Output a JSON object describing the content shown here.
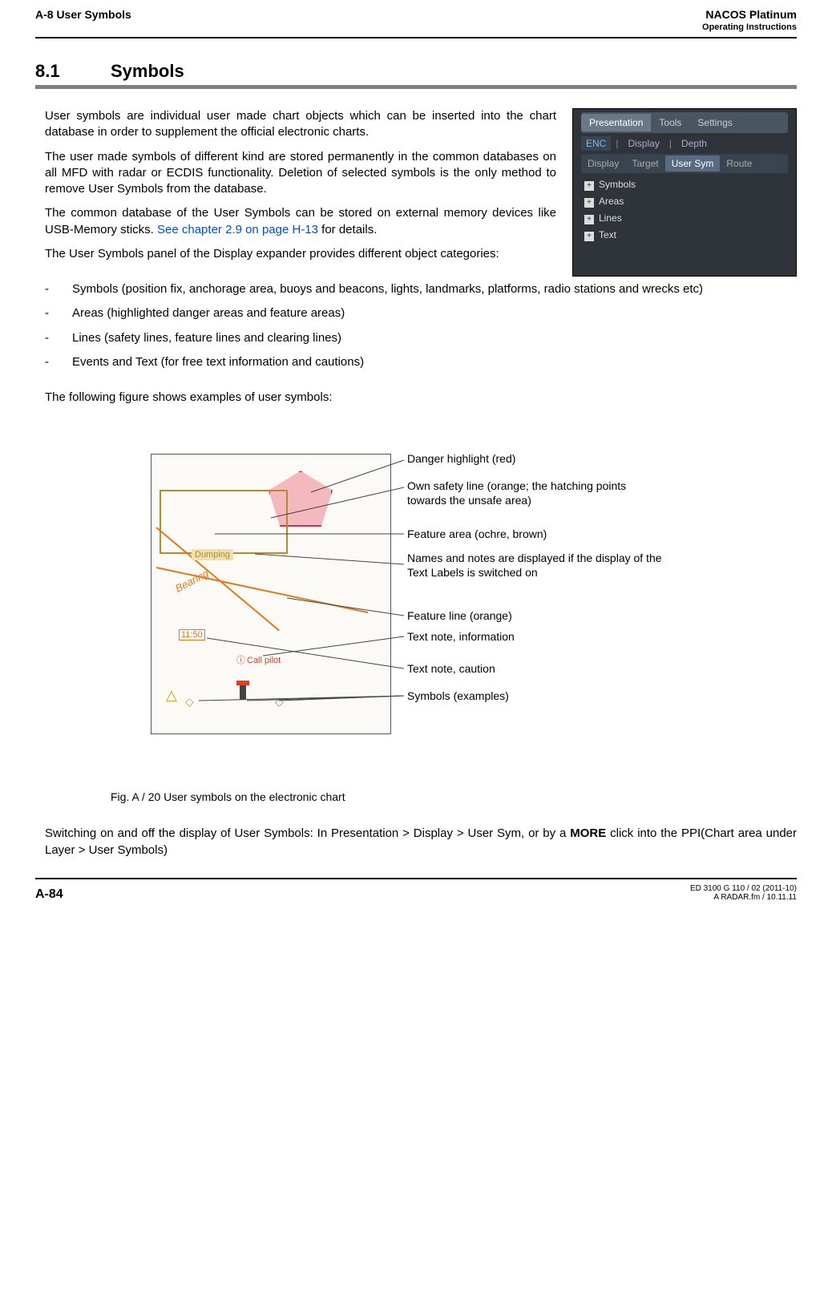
{
  "header": {
    "left": "A-8   User Symbols",
    "right_title": "NACOS Platinum",
    "right_sub": "Operating Instructions"
  },
  "section": {
    "number": "8.1",
    "title": "Symbols"
  },
  "paragraphs": {
    "p1": "User symbols are individual user made chart objects which can be inserted into the chart database in order to supplement the official electronic charts.",
    "p2": "The user made symbols of different kind are stored permanently in the common databases on all MFD with radar or ECDIS functionality. Deletion of selected symbols is the only method to remove User Symbols from the database.",
    "p3a": "The common database of the User Symbols can be stored on external memory devices like USB-Memory sticks. ",
    "p3_link": "See chapter 2.9 on page H-13",
    "p3b": " for details.",
    "p4": "The User Symbols panel of the Display expander provides different object categories:",
    "p5": "The following figure shows examples of user symbols:"
  },
  "bullets": {
    "b1": "Symbols (position fix, anchorage area, buoys and beacons, lights, landmarks, platforms, radio stations and wrecks etc)",
    "b2": "Areas (highlighted danger areas and feature areas)",
    "b3": "Lines (safety lines, feature lines and clearing lines)",
    "b4": "Events and Text (for free text information and cautions)"
  },
  "panel": {
    "tabs1": {
      "a": "Presentation",
      "b": "Tools",
      "c": "Settings"
    },
    "tabs2": {
      "a": "ENC",
      "b": "Display",
      "c": "Depth"
    },
    "tabs3": {
      "a": "Display",
      "b": "Target",
      "c": "User Sym",
      "d": "Route"
    },
    "items": {
      "i1": "Symbols",
      "i2": "Areas",
      "i3": "Lines",
      "i4": "Text"
    }
  },
  "fig": {
    "dumping": "Dumping",
    "bearing": "Bearing",
    "time": "11:50",
    "pilot": "Call pilot",
    "c1": "Danger highlight (red)",
    "c2": "Own safety line (orange; the hatching points towards the unsafe area)",
    "c3": "Feature area (ochre, brown)",
    "c4": "Names and notes are displayed if the display of the Text Labels is switched on",
    "c5": "Feature line (orange)",
    "c6": "Text note, information",
    "c7": "Text note, caution",
    "c8": "Symbols (examples)",
    "caption": "Fig. A /  20   User symbols on the electronic chart"
  },
  "closing": {
    "a": "Switching on and off the display of User Symbols: In Presentation > Display > User Sym, or by a ",
    "more": "MORE",
    "b": " click into the PPI(Chart area under Layer > User Symbols)"
  },
  "footer": {
    "page": "A-84",
    "doc": "ED 3100 G 110 / 02 (2011-10)",
    "file": "A RADAR.fm / 10.11.11"
  }
}
